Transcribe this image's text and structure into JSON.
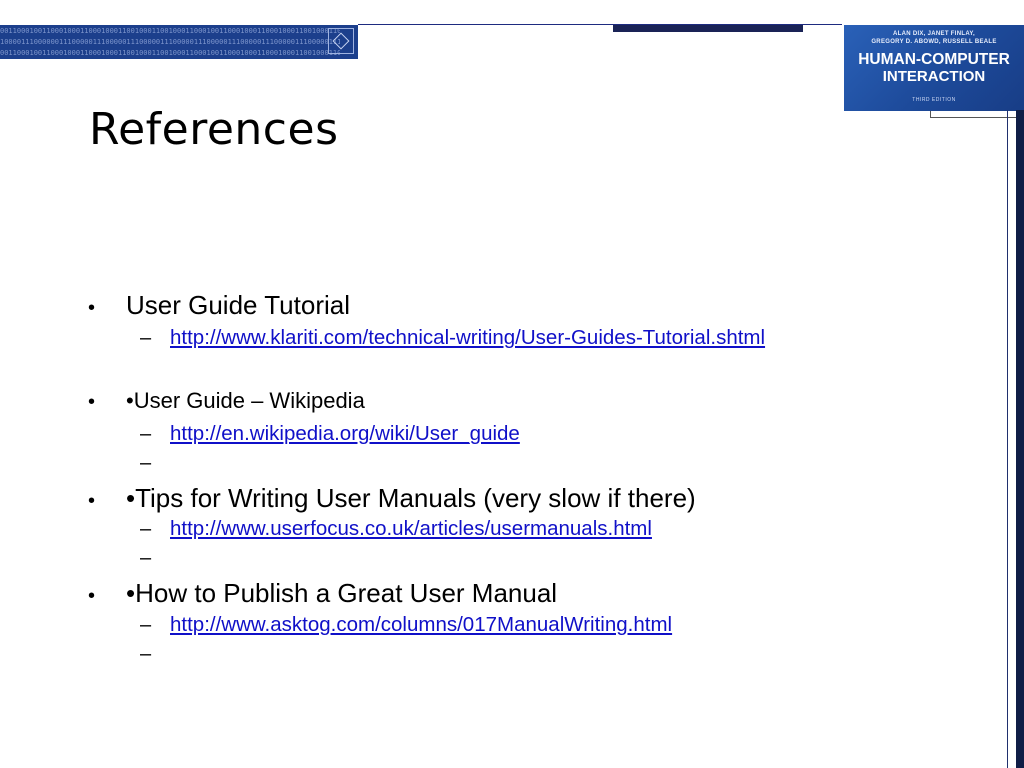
{
  "slide": {
    "title": "References"
  },
  "banner": {
    "binary_line": "0011000100110001000110001000110010001100100011000100110001000110001000110010001100100011000100110001",
    "binary_line_2": "1000011100000011100000111000001110000011100000111000001110000011100000111000001110000011100000111000"
  },
  "cover": {
    "authors_line1": "ALAN DIX, JANET FINLAY,",
    "authors_line2": "GREGORY D. ABOWD, RUSSELL BEALE",
    "title_line1": "HUMAN-COMPUTER",
    "title_line2": "INTERACTION",
    "edition": "THIRD EDITION"
  },
  "references": [
    {
      "bullet": "•",
      "label": "User Guide Tutorial",
      "link": "http://www.klariti.com/technical-writing/User-Guides-Tutorial.shtml"
    },
    {
      "bullet": "•",
      "label": "•User Guide – Wikipedia",
      "link": "http://en.wikipedia.org/wiki/User_guide"
    },
    {
      "bullet": "•",
      "label": "•Tips for Writing User Manuals (very slow if there)",
      "link": "http://www.userfocus.co.uk/articles/usermanuals.html"
    },
    {
      "bullet": "•",
      "label": "•How to Publish a Great User Manual",
      "link": "http://www.asktog.com/columns/017ManualWriting.html"
    }
  ],
  "dash": "–",
  "colors": {
    "banner": "#1c3f8c",
    "link": "#1010c8",
    "right_bar": "#0f1d46"
  }
}
